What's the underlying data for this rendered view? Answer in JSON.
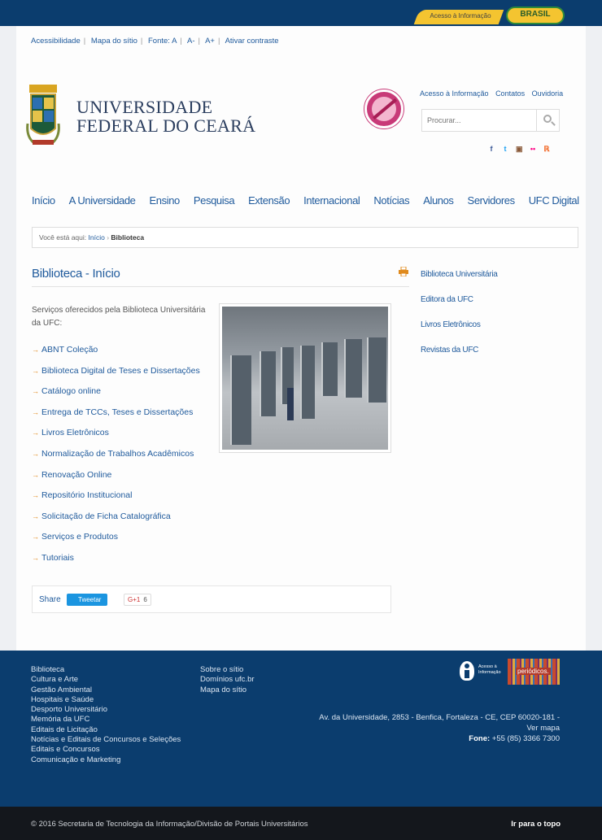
{
  "gov_bar": {
    "info_label": "Acesso à Informação",
    "brasil_label": "BRASIL"
  },
  "accessibility": {
    "items": [
      "Acessibilidade",
      "Mapa do sítio",
      "Fonte:",
      "A",
      "A-",
      "A+",
      "Ativar contraste"
    ]
  },
  "logo": {
    "line1": "UNIVERSIDADE",
    "line2": "FEDERAL DO CEARÁ"
  },
  "top_links": [
    "Acesso à Informação",
    "Contatos",
    "Ouvidoria"
  ],
  "search": {
    "placeholder": "Procurar..."
  },
  "social": [
    "f",
    "t",
    "▣",
    "••",
    "ℝ"
  ],
  "nav": [
    "Início",
    "A Universidade",
    "Ensino",
    "Pesquisa",
    "Extensão",
    "Internacional",
    "Notícias",
    "Alunos",
    "Servidores",
    "UFC Digital"
  ],
  "breadcrumb": {
    "prefix": "Você está aqui:",
    "home": "Início",
    "current": "Biblioteca"
  },
  "page_title": "Biblioteca - Início",
  "intro": "Serviços oferecidos pela Biblioteca Universitária da UFC:",
  "services": [
    "ABNT Coleção",
    "Biblioteca Digital de Teses e Dissertações",
    "Catálogo online",
    "Entrega de TCCs, Teses e Dissertações",
    "Livros Eletrônicos",
    "Normalização de Trabalhos Acadêmicos",
    "Renovação Online",
    "Repositório Institucional",
    "Solicitação de Ficha Catalográfica",
    "Serviços e Produtos",
    "Tutoriais"
  ],
  "share": {
    "label": "Share",
    "tweet": "Tweetar",
    "gplus": "G+1",
    "gplus_count": "6"
  },
  "sidebar": [
    "Biblioteca Universitária",
    "Editora da UFC",
    "Livros Eletrônicos",
    "Revistas da UFC"
  ],
  "footer": {
    "col1": [
      "Biblioteca",
      "Cultura e Arte",
      "Gestão Ambiental",
      "Hospitais e Saúde",
      "Desporto Universitário",
      "Memória da UFC",
      "Editais de Licitação",
      "Notícias e Editais de Concursos e Seleções",
      "Editais e Concursos",
      "Comunicação e Marketing"
    ],
    "col2": [
      "Sobre o sítio",
      "Domínios ufc.br",
      "Mapa do sítio"
    ],
    "info_label": "Acesso à Informação",
    "periodicos": "periódicos.",
    "address": "Av. da Universidade, 2853 - Benfica, Fortaleza - CE, CEP 60020-181 -",
    "map_link": "Ver mapa",
    "phone_label": "Fone:",
    "phone": "+55 (85) 3366 7300"
  },
  "bottom": {
    "copyright": "© 2016 Secretaria de Tecnologia da Informação/Divisão de Portais Universitários",
    "to_top": "Ir para o topo"
  }
}
